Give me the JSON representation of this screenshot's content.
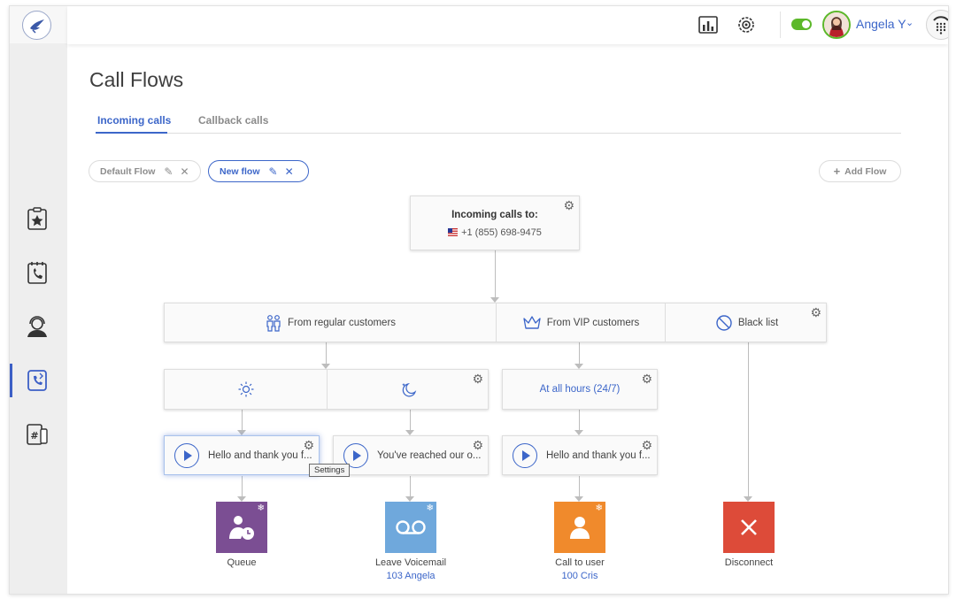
{
  "app": {
    "user_name": "Angela Y"
  },
  "page": {
    "title": "Call Flows",
    "tabs": [
      {
        "label": "Incoming calls"
      },
      {
        "label": "Callback calls"
      }
    ]
  },
  "flows": {
    "chips": [
      {
        "label": "Default Flow"
      },
      {
        "label": "New flow"
      }
    ],
    "add_label": "Add Flow"
  },
  "flow": {
    "incoming": {
      "title": "Incoming calls to:",
      "number": "+1 (855) 698-9475"
    },
    "routes": [
      {
        "label": "From regular customers",
        "icon": "users-icon"
      },
      {
        "label": "From VIP customers",
        "icon": "crown-icon"
      },
      {
        "label": "Black list",
        "icon": "block-icon"
      }
    ],
    "schedule": {
      "vip": "At all hours (24/7)"
    },
    "messages": [
      {
        "text": "Hello and thank you f..."
      },
      {
        "text": "You've reached our o..."
      },
      {
        "text": "Hello and thank you f..."
      }
    ],
    "tooltip": "Settings",
    "actions": [
      {
        "label": "Queue",
        "sub": "",
        "color": "#7b4e93"
      },
      {
        "label": "Leave Voicemail",
        "sub": "103 Angela",
        "color": "#6fa8dc"
      },
      {
        "label": "Call to user",
        "sub": "100 Cris",
        "color": "#f08a2c"
      },
      {
        "label": "Disconnect",
        "sub": "",
        "color": "#dd4b39"
      }
    ]
  },
  "colors": {
    "accent": "#3c66c9",
    "online": "#5cb82a"
  }
}
